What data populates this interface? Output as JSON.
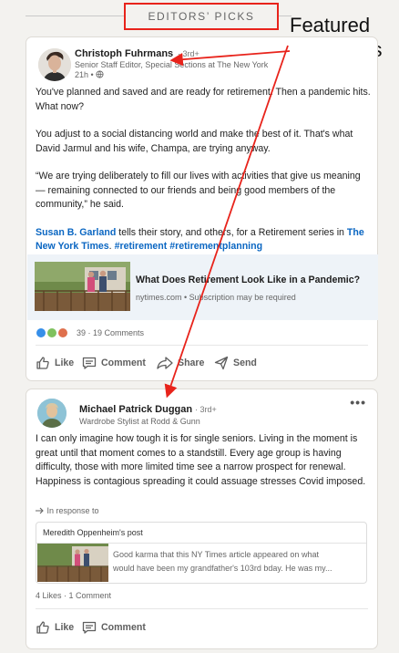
{
  "header": {
    "title": "EDITORS’ PICKS"
  },
  "annotation": {
    "line1": "Featured",
    "line2": "comments"
  },
  "post": {
    "author": "Christoph Fuhrmans",
    "degree": "· 3rd+",
    "headline": "Senior Staff Editor, Special Sections at The New York",
    "time": "21h •",
    "paragraph1": "You've planned and saved and are ready for retirement. Then a pandemic hits. What now?",
    "paragraph2": "You adjust to a social distancing world and make the best of it. That's what David Jarmul and his wife, Champa, are trying anyway.",
    "paragraph3": "“We are trying deliberately to fill our lives with activities that give us meaning — remaining connected to our friends and being good members of the community,” he said.",
    "p4_mention": "Susan B. Garland",
    "p4_text": " tells their story, and others, for a Retirement series in ",
    "p4_company": "The New York Times",
    "p4_dot": ".",
    "p4_tags": " #retirement #retirementplanning",
    "preview_title": "What Does Retirement Look Like in a Pandemic?",
    "preview_source": "nytimes.com • Subscription may be required",
    "reactions_count": "39 · 19 Comments",
    "actions": {
      "like": "Like",
      "comment": "Comment",
      "share": "Share",
      "send": "Send"
    }
  },
  "comment": {
    "author": "Michael Patrick Duggan",
    "degree": "· 3rd+",
    "headline": "Wardrobe Stylist at Rodd & Gunn",
    "more": "•••",
    "text": "I can only imagine how tough it is for single seniors. Living in the moment is great until that moment comes to a standstill. Every age group is having difficulty, those with more limited time see a narrow prospect for renewal. Happiness is contagious spreading it could assuage stresses Covid imposed.",
    "in_response_label": "In response to",
    "quoted_title": "Meredith Oppenheim's post",
    "quoted_line1": "Good karma that this NY Times article appeared on what",
    "quoted_line2": "would have been my grandfather's 103rd bday. He was my...",
    "stats": "4 Likes · 1 Comment",
    "actions": {
      "like": "Like",
      "comment": "Comment"
    }
  },
  "colors": {
    "accent_red": "#e8231b",
    "link_blue": "#0a66c2",
    "background": "#f3f2ef"
  },
  "icons": [
    "like-icon",
    "comment-icon",
    "share-icon",
    "send-icon",
    "globe-icon",
    "arrow-right-icon",
    "more-icon"
  ]
}
